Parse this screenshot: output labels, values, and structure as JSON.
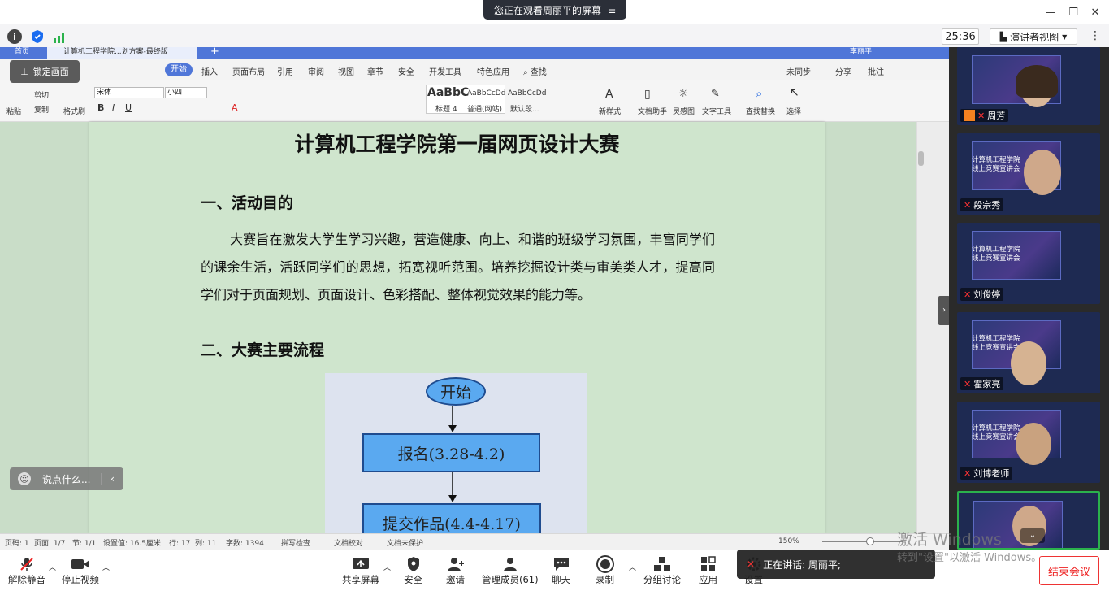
{
  "app": {
    "share_banner": "您正在观看周丽平的屏幕",
    "timer": "25:36",
    "view_label": "演讲者视图",
    "lock_label": "锁定画面",
    "chat_placeholder": "说点什么..."
  },
  "wps": {
    "tabs": [
      "首页",
      "计算机工程学院...划方案-最终版"
    ],
    "menu": [
      "开始",
      "插入",
      "页面布局",
      "引用",
      "审阅",
      "视图",
      "章节",
      "安全",
      "开发工具",
      "特色应用",
      "查找"
    ],
    "menu_right": [
      "未同步",
      "分享",
      "批注"
    ],
    "font_name": "宋体",
    "font_size": "小四",
    "styles": [
      "AaBbC",
      "AaBbCcDd",
      "AaBbCcDd"
    ],
    "style_names": [
      "标题 4",
      "普通(网站)",
      "默认段..."
    ],
    "tools": [
      "新样式",
      "文档助手",
      "灵感图",
      "文字工具",
      "查找替换",
      "选择"
    ],
    "clipboard": [
      "粘贴",
      "剪切",
      "复制",
      "格式刷"
    ],
    "user": "李丽平"
  },
  "document": {
    "title": "计算机工程学院第一届网页设计大赛",
    "h1": "一、活动目的",
    "paragraph": "大赛旨在激发大学生学习兴趣，营造健康、向上、和谐的班级学习氛围，丰富同学们的课余生活，活跃同学们的思想，拓宽视听范围。培养挖掘设计类与审美类人才，提高同学们对于页面规划、页面设计、色彩搭配、整体视觉效果的能力等。",
    "h2": "二、大赛主要流程",
    "flow": {
      "start": "开始",
      "step1": "报名(3.28-4.2)",
      "step2": "提交作品(4.4-4.17)"
    }
  },
  "statusbar": {
    "items": [
      "页码: 1",
      "页面: 1/7",
      "节: 1/1",
      "设置值: 16.5厘米",
      "行: 17",
      "列: 11",
      "字数: 1394",
      "拼写检查",
      "文档校对",
      "文档未保护"
    ],
    "zoom": "150%"
  },
  "participants": [
    {
      "name": "周芳"
    },
    {
      "name": "段宗秀"
    },
    {
      "name": "刘俊婷"
    },
    {
      "name": "霍家亮"
    },
    {
      "name": "刘博老师"
    }
  ],
  "tile_text": [
    "计算机工程学院",
    "线上竞赛宣讲会"
  ],
  "bottombar": {
    "left": [
      "解除静音",
      "停止视频"
    ],
    "center": [
      "共享屏幕",
      "安全",
      "邀请",
      "管理成员(61)",
      "聊天",
      "录制",
      "分组讨论",
      "应用",
      "设置"
    ],
    "speaking": "正在讲话: 周丽平;",
    "end": "结束会议"
  },
  "watermark": {
    "line1": "激活 Windows",
    "line2": "转到\"设置\"以激活 Windows。"
  },
  "colors": {
    "page_bg": "#cfe5cd",
    "wps_accent": "#4f76d8",
    "flow_box": "#5aa9f0",
    "end_red": "#e22222"
  }
}
